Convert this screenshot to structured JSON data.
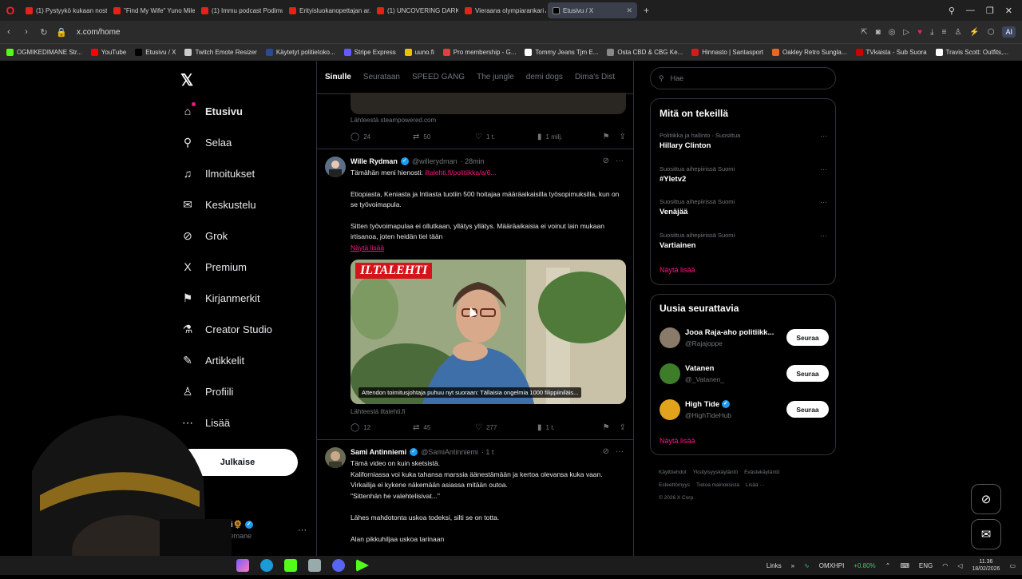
{
  "browser": {
    "tabs": [
      {
        "label": "(1) Pystyykö kukaan noste...",
        "active": false
      },
      {
        "label": "\"Find My Wife\" Yuno Mile...",
        "active": false
      },
      {
        "label": "(1) Immu podcast Podimu...",
        "active": false
      },
      {
        "label": "Erityisluokanopettajan ar...",
        "active": false
      },
      {
        "label": "(1) UNCOVERING DARK E...",
        "active": false
      },
      {
        "label": "Vieraana olympiarankari A...",
        "active": false
      },
      {
        "label": "Etusivu / X",
        "active": true
      }
    ],
    "url": "x.com/home",
    "ai_button": "AI",
    "bookmarks": [
      {
        "label": "OGMIKEDIMANE Str...",
        "color": "#53fc18"
      },
      {
        "label": "YouTube",
        "color": "#ff0000"
      },
      {
        "label": "Etusivu / X",
        "color": "#000000"
      },
      {
        "label": "Twitch Emote Resizer",
        "color": "#cccccc"
      },
      {
        "label": "Käytetyt politietoko...",
        "color": "#2a4b8d"
      },
      {
        "label": "Stripe Express",
        "color": "#635bff"
      },
      {
        "label": "uuno.fi",
        "color": "#f0c000"
      },
      {
        "label": "Pro membership - G...",
        "color": "#e04040"
      },
      {
        "label": "Tommy Jeans Tjm E...",
        "color": "#ffffff"
      },
      {
        "label": "Osta CBD & CBG Ke...",
        "color": "#888888"
      },
      {
        "label": "Hinnasto | Santasport",
        "color": "#d21c1c"
      },
      {
        "label": "Oakley Retro Sungla...",
        "color": "#e8662a"
      },
      {
        "label": "TVkaista - Sub Suora",
        "color": "#cc0000"
      },
      {
        "label": "Travis Scott: Outfits,...",
        "color": "#ffffff"
      }
    ]
  },
  "nav": {
    "items": [
      {
        "label": "Etusivu",
        "icon": "home-icon",
        "glyph": "⌂"
      },
      {
        "label": "Selaa",
        "icon": "search-icon",
        "glyph": "⚲"
      },
      {
        "label": "Ilmoitukset",
        "icon": "bell-icon",
        "glyph": "♫"
      },
      {
        "label": "Keskustelu",
        "icon": "mail-icon",
        "glyph": "✉"
      },
      {
        "label": "Grok",
        "icon": "grok-icon",
        "glyph": "⊘"
      },
      {
        "label": "Premium",
        "icon": "x-icon",
        "glyph": "X"
      },
      {
        "label": "Kirjanmerkit",
        "icon": "bookmark-icon",
        "glyph": "⚑"
      },
      {
        "label": "Creator Studio",
        "icon": "creator-icon",
        "glyph": "⚗"
      },
      {
        "label": "Artikkelit",
        "icon": "article-icon",
        "glyph": "✎"
      },
      {
        "label": "Profiili",
        "icon": "profile-icon",
        "glyph": "♙"
      },
      {
        "label": "Lisää",
        "icon": "more-icon",
        "glyph": "⋯"
      }
    ],
    "post_button": "Julkaise",
    "account_name": "mikedi🌻",
    "account_handle": "@mikkemane"
  },
  "feed": {
    "tabs": [
      "Sinulle",
      "Seurataan",
      "SPEED GANG",
      "The jungle",
      "demi dogs",
      "Dima's Dist"
    ],
    "top_post": {
      "source": "Lähteestä steampowered.com",
      "replies": "24",
      "reposts": "50",
      "likes": "1 t.",
      "views": "1 milj."
    },
    "post1": {
      "name": "Wille Rydman",
      "handle": "@willerydman",
      "time": "· 28min",
      "line1_prefix": "Tämähän meni hienosti:",
      "line1_link": "iltalehti.fi/politiikka/a/6...",
      "para1": "Etiopiasta, Keniasta ja Intiasta tuotiin 500 hoitajaa määräaikaisilla työsopimuksilla, kun on se työvoimapula.",
      "para2": "Sitten työvoimapulaa ei ollutkaan, yllätys yllätys. Määräaikaisia ei voinut lain mukaan irtisanoa, joten heidän tiel tään",
      "show_more": "Näytä lisää",
      "card_logo": "ILTALEHTI",
      "card_caption": "Attendon toimitusjohtaja puhuu nyt suoraan: Tällaisia ongelmia 1000 filippiiniläis...",
      "source": "Lähteestä iltalehti.fi",
      "replies": "12",
      "reposts": "45",
      "likes": "277",
      "views": "1 t."
    },
    "post2": {
      "name": "Sami Antinniemi",
      "handle": "@SamiAntinniemi",
      "time": "· 1 t",
      "lines": [
        "Tämä video on kuin sketsistä.",
        "Kaliforniassa voi kuka tahansa marssia äänestämään ja kertoa olevansa kuka vaan.",
        "Virkailija ei kykene näkemään asiassa mitään outoa.",
        "\"Sittenhän he valehtelisivat...\"",
        "",
        "Lähes mahdotonta uskoa todeksi, silti se on totta.",
        "",
        "Alan pikkuhiljaa uskoa tarinaan"
      ]
    }
  },
  "right": {
    "search_placeholder": "Hae",
    "trends_title": "Mitä on tekeillä",
    "trends": [
      {
        "context": "Politiikka ja hallinto · Suosittua",
        "topic": "Hillary Clinton"
      },
      {
        "context": "Suosittua aihepiirissä Suomi",
        "topic": "#Yletv2"
      },
      {
        "context": "Suosittua aihepiirissä Suomi",
        "topic": "Venäjää"
      },
      {
        "context": "Suosittua aihepiirissä Suomi",
        "topic": "Vartiainen"
      }
    ],
    "trends_more": "Näytä lisää",
    "follow_title": "Uusia seurattavia",
    "follow": [
      {
        "name": "Jooa Raja-aho politiikk...",
        "handle": "@Rajajoppe",
        "button": "Seuraa",
        "color": "#8a7a6a"
      },
      {
        "name": "Vatanen",
        "handle": "@_Vatanen_",
        "button": "Seuraa",
        "color": "#3d7d2a"
      },
      {
        "name": "High Tide",
        "handle": "@HighTideHub",
        "button": "Seuraa",
        "color": "#e2a31c"
      }
    ],
    "follow_more": "Näytä lisää",
    "footer": [
      "Käyttöehdot",
      "Yksityisyyskäytäntö",
      "Evästekäytäntö",
      "Esteettömyys",
      "Tietoa mainoksista",
      "Lisää ···",
      "© 2026 X Corp."
    ]
  },
  "taskbar": {
    "links": "Links",
    "stock_name": "OMXHPI",
    "stock_change": "+0.80%",
    "lang": "ENG",
    "time": "11.36",
    "date": "18/02/2026"
  }
}
